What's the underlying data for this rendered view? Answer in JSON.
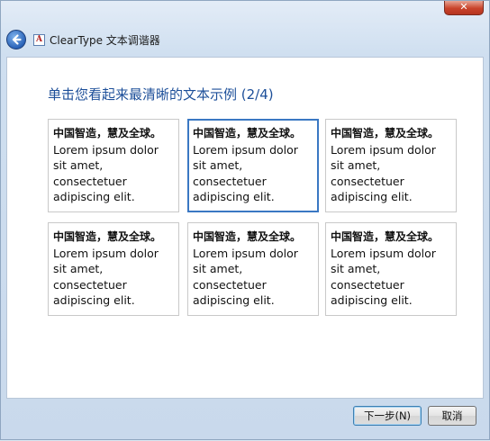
{
  "window": {
    "title": "ClearType 文本调谐器",
    "app_icon_glyph": "A",
    "close_glyph": "✕"
  },
  "main": {
    "heading": "单击您看起来最清晰的文本示例 (2/4)",
    "samples": [
      {
        "lines": [
          "中国智造，慧及全球。",
          "Lorem ipsum dolor",
          "sit amet,",
          "consectetuer",
          "adipiscing elit."
        ],
        "selected": false
      },
      {
        "lines": [
          "中国智造，慧及全球。",
          "Lorem ipsum dolor",
          "sit amet,",
          "consectetuer",
          "adipiscing elit."
        ],
        "selected": true
      },
      {
        "lines": [
          "中国智造，慧及全球。",
          "Lorem ipsum dolor",
          "sit amet,",
          "consectetuer",
          "adipiscing elit."
        ],
        "selected": false
      },
      {
        "lines": [
          "中国智造，慧及全球。",
          "Lorem ipsum dolor",
          "sit amet,",
          "consectetuer",
          "adipiscing elit."
        ],
        "selected": false
      },
      {
        "lines": [
          "中国智造，慧及全球。",
          "Lorem ipsum dolor",
          "sit amet,",
          "consectetuer",
          "adipiscing elit."
        ],
        "selected": false
      },
      {
        "lines": [
          "中国智造，慧及全球。",
          "Lorem ipsum dolor",
          "sit amet,",
          "consectetuer",
          "adipiscing elit."
        ],
        "selected": false
      }
    ]
  },
  "footer": {
    "next_label": "下一步(N)",
    "cancel_label": "取消"
  },
  "colors": {
    "heading": "#1d4f99",
    "selected_border": "#3a78c3",
    "close_button": "#c9432b"
  },
  "icons": {
    "back": "back-arrow-icon",
    "app": "cleartype-app-icon",
    "close": "close-icon"
  }
}
